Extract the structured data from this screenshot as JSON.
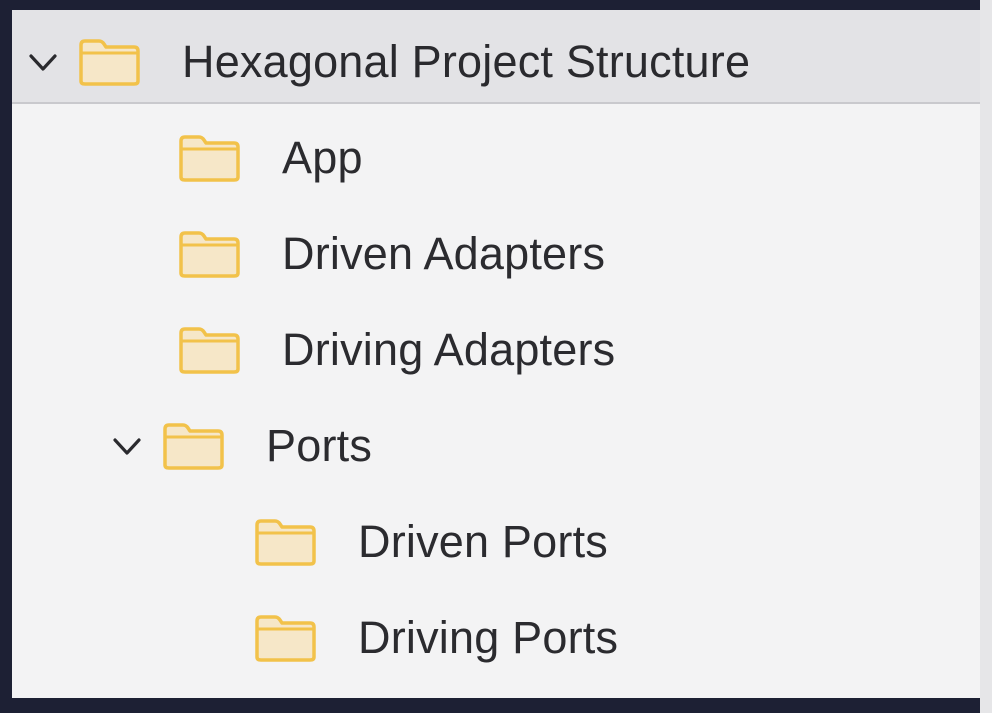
{
  "tree": {
    "root": {
      "label": "Hexagonal Project Structure",
      "expanded": true,
      "children": [
        {
          "label": "App"
        },
        {
          "label": "Driven Adapters"
        },
        {
          "label": "Driving Adapters"
        },
        {
          "label": "Ports",
          "expanded": true,
          "children": [
            {
              "label": "Driven Ports"
            },
            {
              "label": "Driving Ports"
            }
          ]
        }
      ]
    }
  },
  "icons": {
    "expand": "chevron-down-icon",
    "folder": "folder-icon"
  },
  "colors": {
    "folder_fill": "#f6e7c8",
    "folder_stroke": "#f2c24a",
    "panel_bg": "#f3f3f4",
    "selected_row_bg": "#e3e3e6",
    "backdrop": "#1d2034"
  }
}
